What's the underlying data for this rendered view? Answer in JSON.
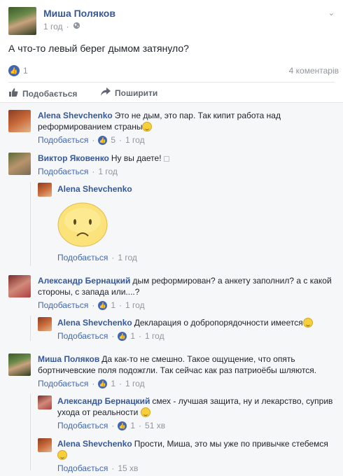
{
  "post": {
    "author": "Миша Поляков",
    "time": "1 год",
    "text": "А что-то левый берег дымом затянуло?",
    "likes": "1",
    "comments_count": "4 коментарів",
    "actions": {
      "like": "Подобається",
      "share": "Поширити"
    }
  },
  "comments": [
    {
      "name": "Alena Shevchenko",
      "text": "Это не дым, это пар. Так кипит работа над реформированием страны",
      "like_label": "Подобається",
      "likes": "5",
      "time": "1 год"
    },
    {
      "name": "Виктор Яковенко",
      "text": "Ну вы даете!",
      "like_label": "Подобається",
      "time": "1 год",
      "reply": {
        "name": "Alena Shevchenko",
        "like_label": "Подобається",
        "time": "1 год"
      }
    },
    {
      "name": "Александр Бернацкий",
      "text": "дым реформирован? а анкету заполнил? а с какой стороны, с запада или....?",
      "like_label": "Подобається",
      "likes": "1",
      "time": "1 год",
      "reply": {
        "name": "Alena Shevchenko",
        "text": "Декларация о добропорядочности имеется",
        "like_label": "Подобається",
        "likes": "1",
        "time": "1 год"
      }
    },
    {
      "name": "Миша Поляков",
      "text": "Да как-то не смешно. Такое ощущение, что опять бортничевские поля подожгли. Так сейчас как раз патриоёбы шляются.",
      "like_label": "Подобається",
      "likes": "1",
      "time": "1 год",
      "replies": [
        {
          "name": "Александр Бернацкий",
          "text": "смех - лучшая защита, ну и лекарство, суприв ухода от реальности",
          "like_label": "Подобається",
          "likes": "1",
          "time": "51 хв"
        },
        {
          "name": "Alena Shevchenko",
          "text": "Прости, Миша, это мы уже по привычке стебемся",
          "like_label": "Подобається",
          "time": "15 хв"
        }
      ]
    }
  ]
}
